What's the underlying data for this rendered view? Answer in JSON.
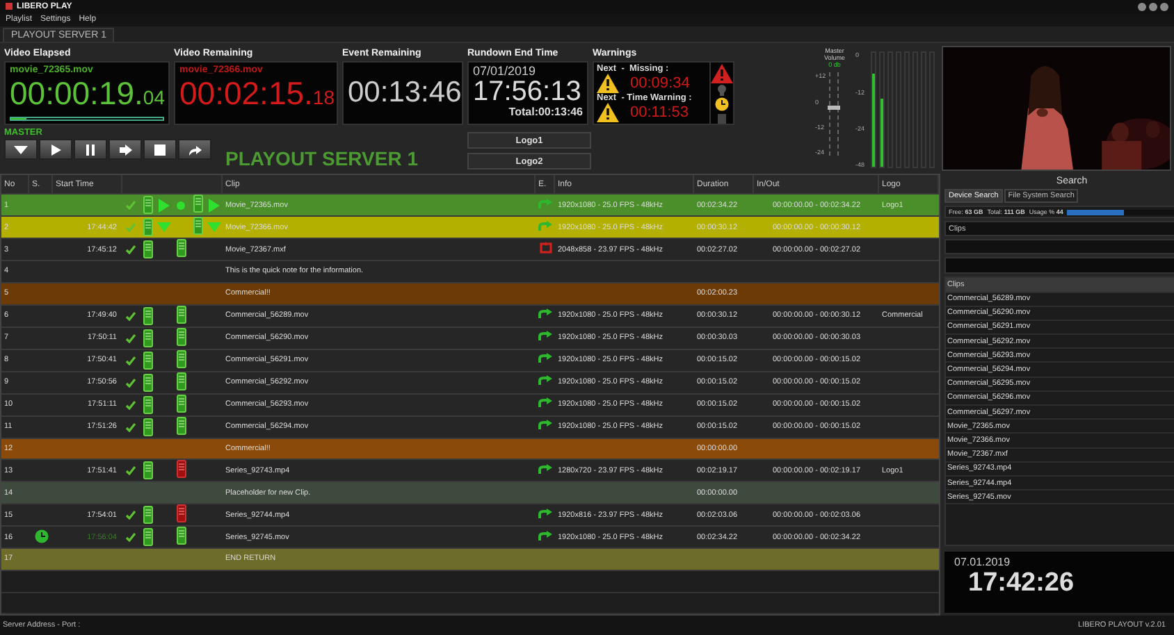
{
  "window": {
    "title": "LIBERO PLAY"
  },
  "menu": [
    "Playlist",
    "Settings",
    "Help"
  ],
  "server_tab": "PLAYOUT SERVER 1",
  "video_elapsed": {
    "label": "Video Elapsed",
    "clip": "movie_72365.mov",
    "time": "00:00:19.",
    "frames": "04",
    "level": 0.1
  },
  "video_remaining": {
    "label": "Video Remaining",
    "clip": "movie_72366.mov",
    "time": "00:02:15.",
    "frames": "18"
  },
  "event_remaining": {
    "label": "Event Remaining",
    "time": "00:13:46"
  },
  "rundown_end": {
    "label": "Rundown End Time",
    "date": "07/01/2019",
    "time": "17:56:13",
    "total": "Total:00:13:46"
  },
  "warnings": {
    "label": "Warnings",
    "items": [
      {
        "label": "Next  -  Missing :",
        "time": "00:09:34"
      },
      {
        "label": "Next  - Time Warning :",
        "time": "00:11:53"
      }
    ]
  },
  "master": {
    "label": "MASTER",
    "server": "PLAYOUT SERVER 1"
  },
  "logos": [
    "Logo1",
    "Logo2"
  ],
  "volume": {
    "label": "Master Volume",
    "reading": "0 db",
    "level": 0.55,
    "scale": [
      "+12",
      "0",
      "-12",
      "-24"
    ]
  },
  "meters": {
    "scale": [
      "0",
      "-12",
      "-24",
      "-48"
    ],
    "channels": [
      {
        "level": 0.82
      },
      {
        "level": 0.6
      },
      {
        "level": 0
      },
      {
        "level": 0
      },
      {
        "level": 0
      },
      {
        "level": 0
      },
      {
        "level": 0
      },
      {
        "level": 0
      }
    ]
  },
  "table": {
    "columns": [
      "No",
      "S.",
      "Start Time",
      "Clip",
      "E.",
      "Info",
      "Duration",
      "In/Out",
      "Logo"
    ],
    "rows": [
      {
        "kind": "clip",
        "no": "1",
        "playing": true,
        "cued": false,
        "start": "",
        "clip": "Movie_72365.mov",
        "backup_ready": true,
        "error": false,
        "info": "1920x1080 - 25.0 FPS - 48kHz",
        "duration": "00:02:34.22",
        "inout": "00:00:00.00 - 00:02:34.22",
        "logo": "Logo1"
      },
      {
        "kind": "clip",
        "no": "2",
        "playing": false,
        "cued": true,
        "start": "17:44:42",
        "clip": "Movie_72366.mov",
        "backup_ready": true,
        "error": false,
        "info": "1920x1080 - 25.0 FPS - 48kHz",
        "duration": "00:00:30.12",
        "inout": "00:00:00.00 - 00:00:30.12",
        "logo": ""
      },
      {
        "kind": "clip",
        "no": "3",
        "playing": false,
        "cued": false,
        "start": "17:45:12",
        "clip": "Movie_72367.mxf",
        "backup_ready": true,
        "error": true,
        "info": "2048x858 - 23.97 FPS - 48kHz",
        "duration": "00:02:27.02",
        "inout": "00:00:00.00 - 00:02:27.02",
        "logo": ""
      },
      {
        "kind": "note",
        "no": "4",
        "clip": "This is the quick note for the information."
      },
      {
        "kind": "group",
        "no": "5",
        "clip": "Commercial!!",
        "duration": "00:02:00.23",
        "color": "#6b3a06"
      },
      {
        "kind": "clip",
        "no": "6",
        "playing": false,
        "cued": false,
        "start": "17:49:40",
        "clip": "Commercial_56289.mov",
        "backup_ready": true,
        "error": false,
        "info": "1920x1080 - 25.0 FPS - 48kHz",
        "duration": "00:00:30.12",
        "inout": "00:00:00.00 - 00:00:30.12",
        "logo": "Commercial"
      },
      {
        "kind": "clip",
        "no": "7",
        "playing": false,
        "cued": false,
        "start": "17:50:11",
        "clip": "Commercial_56290.mov",
        "backup_ready": true,
        "error": false,
        "info": "1920x1080 - 25.0 FPS - 48kHz",
        "duration": "00:00:30.03",
        "inout": "00:00:00.00 - 00:00:30.03",
        "logo": ""
      },
      {
        "kind": "clip",
        "no": "8",
        "playing": false,
        "cued": false,
        "start": "17:50:41",
        "clip": "Commercial_56291.mov",
        "backup_ready": true,
        "error": false,
        "info": "1920x1080 - 25.0 FPS - 48kHz",
        "duration": "00:00:15.02",
        "inout": "00:00:00.00 - 00:00:15.02",
        "logo": ""
      },
      {
        "kind": "clip",
        "no": "9",
        "playing": false,
        "cued": false,
        "start": "17:50:56",
        "clip": "Commercial_56292.mov",
        "backup_ready": true,
        "error": false,
        "info": "1920x1080 - 25.0 FPS - 48kHz",
        "duration": "00:00:15.02",
        "inout": "00:00:00.00 - 00:00:15.02",
        "logo": ""
      },
      {
        "kind": "clip",
        "no": "10",
        "playing": false,
        "cued": false,
        "start": "17:51:11",
        "clip": "Commercial_56293.mov",
        "backup_ready": true,
        "error": false,
        "info": "1920x1080 - 25.0 FPS - 48kHz",
        "duration": "00:00:15.02",
        "inout": "00:00:00.00 - 00:00:15.02",
        "logo": ""
      },
      {
        "kind": "clip",
        "no": "11",
        "playing": false,
        "cued": false,
        "start": "17:51:26",
        "clip": "Commercial_56294.mov",
        "backup_ready": true,
        "error": false,
        "info": "1920x1080 - 25.0 FPS - 48kHz",
        "duration": "00:00:15.02",
        "inout": "00:00:00.00 - 00:00:15.02",
        "logo": ""
      },
      {
        "kind": "group",
        "no": "12",
        "clip": "Commercial!!",
        "duration": "00:00:00.00",
        "color": "#8a4a0a"
      },
      {
        "kind": "clip",
        "no": "13",
        "playing": false,
        "cued": false,
        "start": "17:51:41",
        "clip": "Series_92743.mp4",
        "backup_ready": false,
        "error": false,
        "info": "1280x720 - 23.97 FPS - 48kHz",
        "duration": "00:02:19.17",
        "inout": "00:00:00.00 - 00:02:19.17",
        "logo": "Logo1"
      },
      {
        "kind": "placeholder",
        "no": "14",
        "clip": "Placeholder for new Clip.",
        "duration": "00:00:00.00",
        "color": "#3e4a3e"
      },
      {
        "kind": "clip",
        "no": "15",
        "playing": false,
        "cued": false,
        "start": "17:54:01",
        "clip": "Series_92744.mp4",
        "backup_ready": false,
        "error": false,
        "info": "1920x816 - 23.97 FPS - 48kHz",
        "duration": "00:02:03.06",
        "inout": "00:00:00.00 - 00:02:03.06",
        "logo": ""
      },
      {
        "kind": "clip",
        "no": "16",
        "playing": false,
        "cued": false,
        "timed": true,
        "start": "17:56:04",
        "clip": "Series_92745.mov",
        "backup_ready": true,
        "error": false,
        "info": "1920x1080 - 25.0 FPS - 48kHz",
        "duration": "00:02:34.22",
        "inout": "00:00:00.00 - 00:02:34.22",
        "logo": ""
      },
      {
        "kind": "end",
        "no": "17",
        "clip": "END RETURN",
        "color": "#6e6c2a"
      }
    ]
  },
  "search": {
    "title": "Search",
    "tabs": [
      {
        "label": "Device Search",
        "selected": true
      },
      {
        "label": "File System Search",
        "selected": false
      }
    ],
    "free_label": "Free:",
    "free": "63 GB",
    "total_label": "Total:",
    "total": "111 GB",
    "usage_label": "Usage %",
    "usage": "44",
    "level": 0.44,
    "category": "Clips",
    "list_header": "Clips",
    "items": [
      "Commercial_56289.mov",
      "Commercial_56290.mov",
      "Commercial_56291.mov",
      "Commercial_56292.mov",
      "Commercial_56293.mov",
      "Commercial_56294.mov",
      "Commercial_56295.mov",
      "Commercial_56296.mov",
      "Commercial_56297.mov",
      "Movie_72365.mov",
      "Movie_72366.mov",
      "Movie_72367.mxf",
      "Series_92743.mp4",
      "Series_92744.mp4",
      "Series_92745.mov"
    ]
  },
  "clock": {
    "date": "07.01.2019",
    "time": "17:42:26"
  },
  "status_bar": {
    "left": "Server Address - Port :",
    "right": "LIBERO PLAYOUT v.2.01"
  }
}
